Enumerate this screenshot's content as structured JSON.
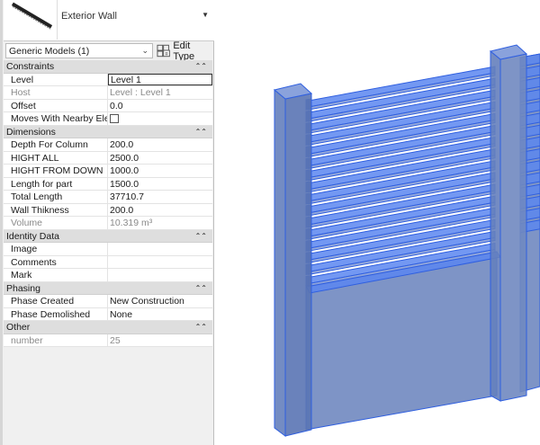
{
  "type_selector": {
    "type_name": "Exterior Wall"
  },
  "category": {
    "selected": "Generic Models (1)",
    "edit_type_label": "Edit Type"
  },
  "groups": [
    {
      "label": "Constraints",
      "rows": [
        {
          "key": "Level",
          "value": "Level 1",
          "active": true
        },
        {
          "key": "Host",
          "value": "Level : Level 1",
          "readonly": true
        },
        {
          "key": "Offset",
          "value": "0.0"
        },
        {
          "key": "Moves With Nearby Ele...",
          "checkbox": false
        }
      ]
    },
    {
      "label": "Dimensions",
      "rows": [
        {
          "key": "Depth For Column",
          "value": "200.0"
        },
        {
          "key": "HIGHT ALL",
          "value": "2500.0"
        },
        {
          "key": "HIGHT FROM DOWN",
          "value": "1000.0"
        },
        {
          "key": "Length for part",
          "value": "1500.0"
        },
        {
          "key": "Total Length",
          "value": "37710.7"
        },
        {
          "key": "Wall Thikness",
          "value": "200.0"
        },
        {
          "key": "Volume",
          "value": "10.319 m³",
          "readonly": true
        }
      ]
    },
    {
      "label": "Identity Data",
      "rows": [
        {
          "key": "Image",
          "value": ""
        },
        {
          "key": "Comments",
          "value": ""
        },
        {
          "key": "Mark",
          "value": ""
        }
      ]
    },
    {
      "label": "Phasing",
      "rows": [
        {
          "key": "Phase Created",
          "value": "New Construction"
        },
        {
          "key": "Phase Demolished",
          "value": "None"
        }
      ]
    },
    {
      "label": "Other",
      "rows": [
        {
          "key": "number",
          "value": "25",
          "readonly": true
        }
      ]
    }
  ],
  "colors": {
    "model_fill": "#7088c0",
    "model_edge": "#2f5fe0",
    "slat": "#5a86f0"
  }
}
